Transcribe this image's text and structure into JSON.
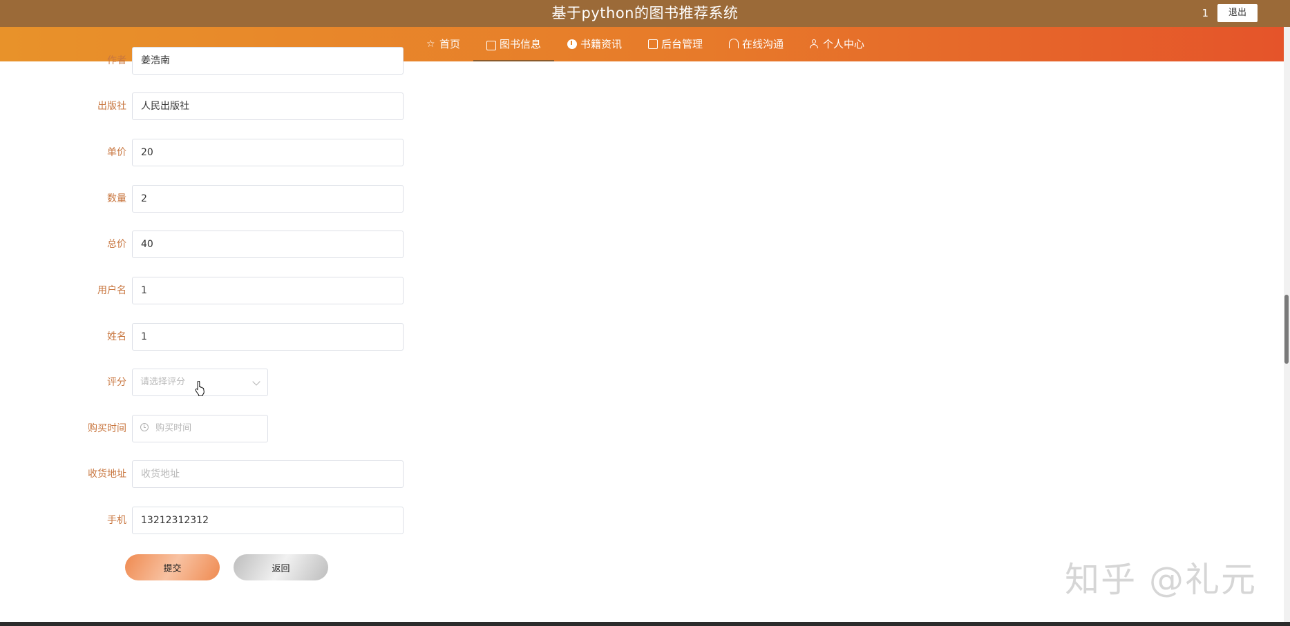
{
  "header": {
    "title": "基于python的图书推荐系统",
    "username": "1",
    "logout_label": "退出"
  },
  "nav": {
    "items": [
      {
        "label": "首页",
        "icon": "star-icon"
      },
      {
        "label": "图书信息",
        "icon": "bag-icon",
        "active": true
      },
      {
        "label": "书籍资讯",
        "icon": "info-icon"
      },
      {
        "label": "后台管理",
        "icon": "box-icon"
      },
      {
        "label": "在线沟通",
        "icon": "headset-icon"
      },
      {
        "label": "个人中心",
        "icon": "user-icon"
      }
    ]
  },
  "form": {
    "author_label": "作者",
    "author_value": "姜浩南",
    "publisher_label": "出版社",
    "publisher_value": "人民出版社",
    "price_label": "单价",
    "price_value": "20",
    "quantity_label": "数量",
    "quantity_value": "2",
    "total_label": "总价",
    "total_value": "40",
    "username_label": "用户名",
    "username_value": "1",
    "name_label": "姓名",
    "name_value": "1",
    "rating_label": "评分",
    "rating_placeholder": "请选择评分",
    "purchase_time_label": "购买时间",
    "purchase_time_placeholder": "购买时间",
    "address_label": "收货地址",
    "address_placeholder": "收货地址",
    "phone_label": "手机",
    "phone_value": "13212312312"
  },
  "buttons": {
    "submit_label": "提交",
    "back_label": "返回"
  },
  "watermark": "知乎 @礼元",
  "colors": {
    "topbar": "#9b6a38",
    "navbar_start": "#e8922a",
    "navbar_end": "#e5542a",
    "label": "#c8763f"
  }
}
